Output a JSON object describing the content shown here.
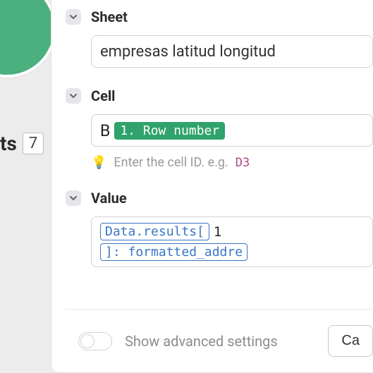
{
  "leftFragment": {
    "text": "ts",
    "box": "7"
  },
  "fields": {
    "sheet": {
      "label": "Sheet",
      "value": "empresas latitud longitud"
    },
    "cell": {
      "label": "Cell",
      "prefix": "B",
      "pill": "1. Row number",
      "hint_text": "Enter the cell ID. e.g.",
      "hint_example": "D3"
    },
    "value": {
      "label": "Value",
      "token1": "Data.results[",
      "seg": "1",
      "token2": "]: formatted_addre"
    }
  },
  "footer": {
    "toggle_label": "Show advanced settings",
    "button": "Ca"
  }
}
